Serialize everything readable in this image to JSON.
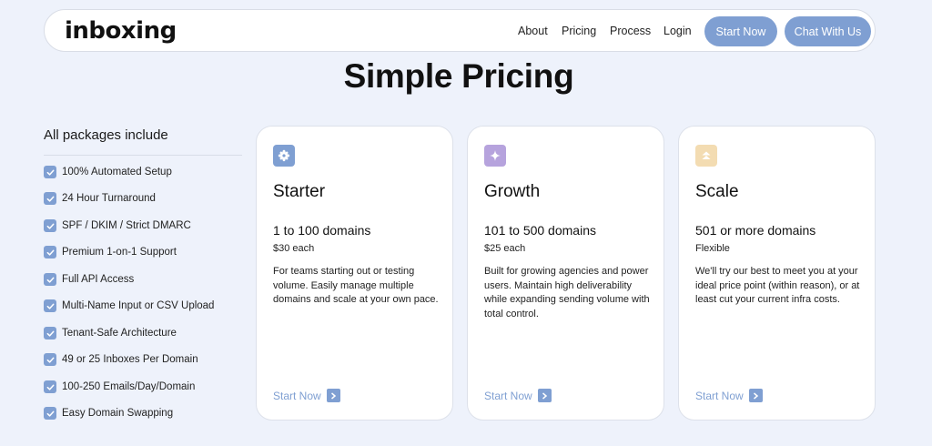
{
  "brand": {
    "logo": "inboxing"
  },
  "nav": {
    "links": [
      "About",
      "Pricing",
      "Process",
      "Login"
    ],
    "start_now": "Start Now",
    "chat": "Chat With Us"
  },
  "page_title": "Simple Pricing",
  "includes": {
    "title": "All packages include",
    "items": [
      "100% Automated Setup",
      "24 Hour Turnaround",
      "SPF / DKIM / Strict DMARC",
      "Premium 1-on-1 Support",
      "Full API Access",
      "Multi-Name Input or CSV Upload",
      "Tenant-Safe Architecture",
      "49 or 25 Inboxes Per Domain",
      "100-250 Emails/Day/Domain",
      "Easy Domain Swapping"
    ]
  },
  "plans": [
    {
      "name": "Starter",
      "icon": "flower-icon",
      "icon_bg": "#7f9fd2",
      "range": "1 to 100 domains",
      "price": "$30 each",
      "description": "For teams starting out or testing volume. Easily manage multiple domains and scale at your own pace.",
      "cta": "Start Now"
    },
    {
      "name": "Growth",
      "icon": "sparkle-icon",
      "icon_bg": "#b6a3dd",
      "range": "101 to 500 domains",
      "price": "$25 each",
      "description": "Built for growing agencies and power users. Maintain high deliverability while expanding sending volume with total control.",
      "cta": "Start Now"
    },
    {
      "name": "Scale",
      "icon": "double-chevron-up-icon",
      "icon_bg": "#f3dcb2",
      "range": "501 or more domains",
      "price": "Flexible",
      "description": "We'll try our best to meet you at your ideal price point (within reason), or at least cut your current infra costs.",
      "cta": "Start Now"
    }
  ],
  "colors": {
    "accent": "#7f9fd2",
    "background": "#eef2fb"
  }
}
